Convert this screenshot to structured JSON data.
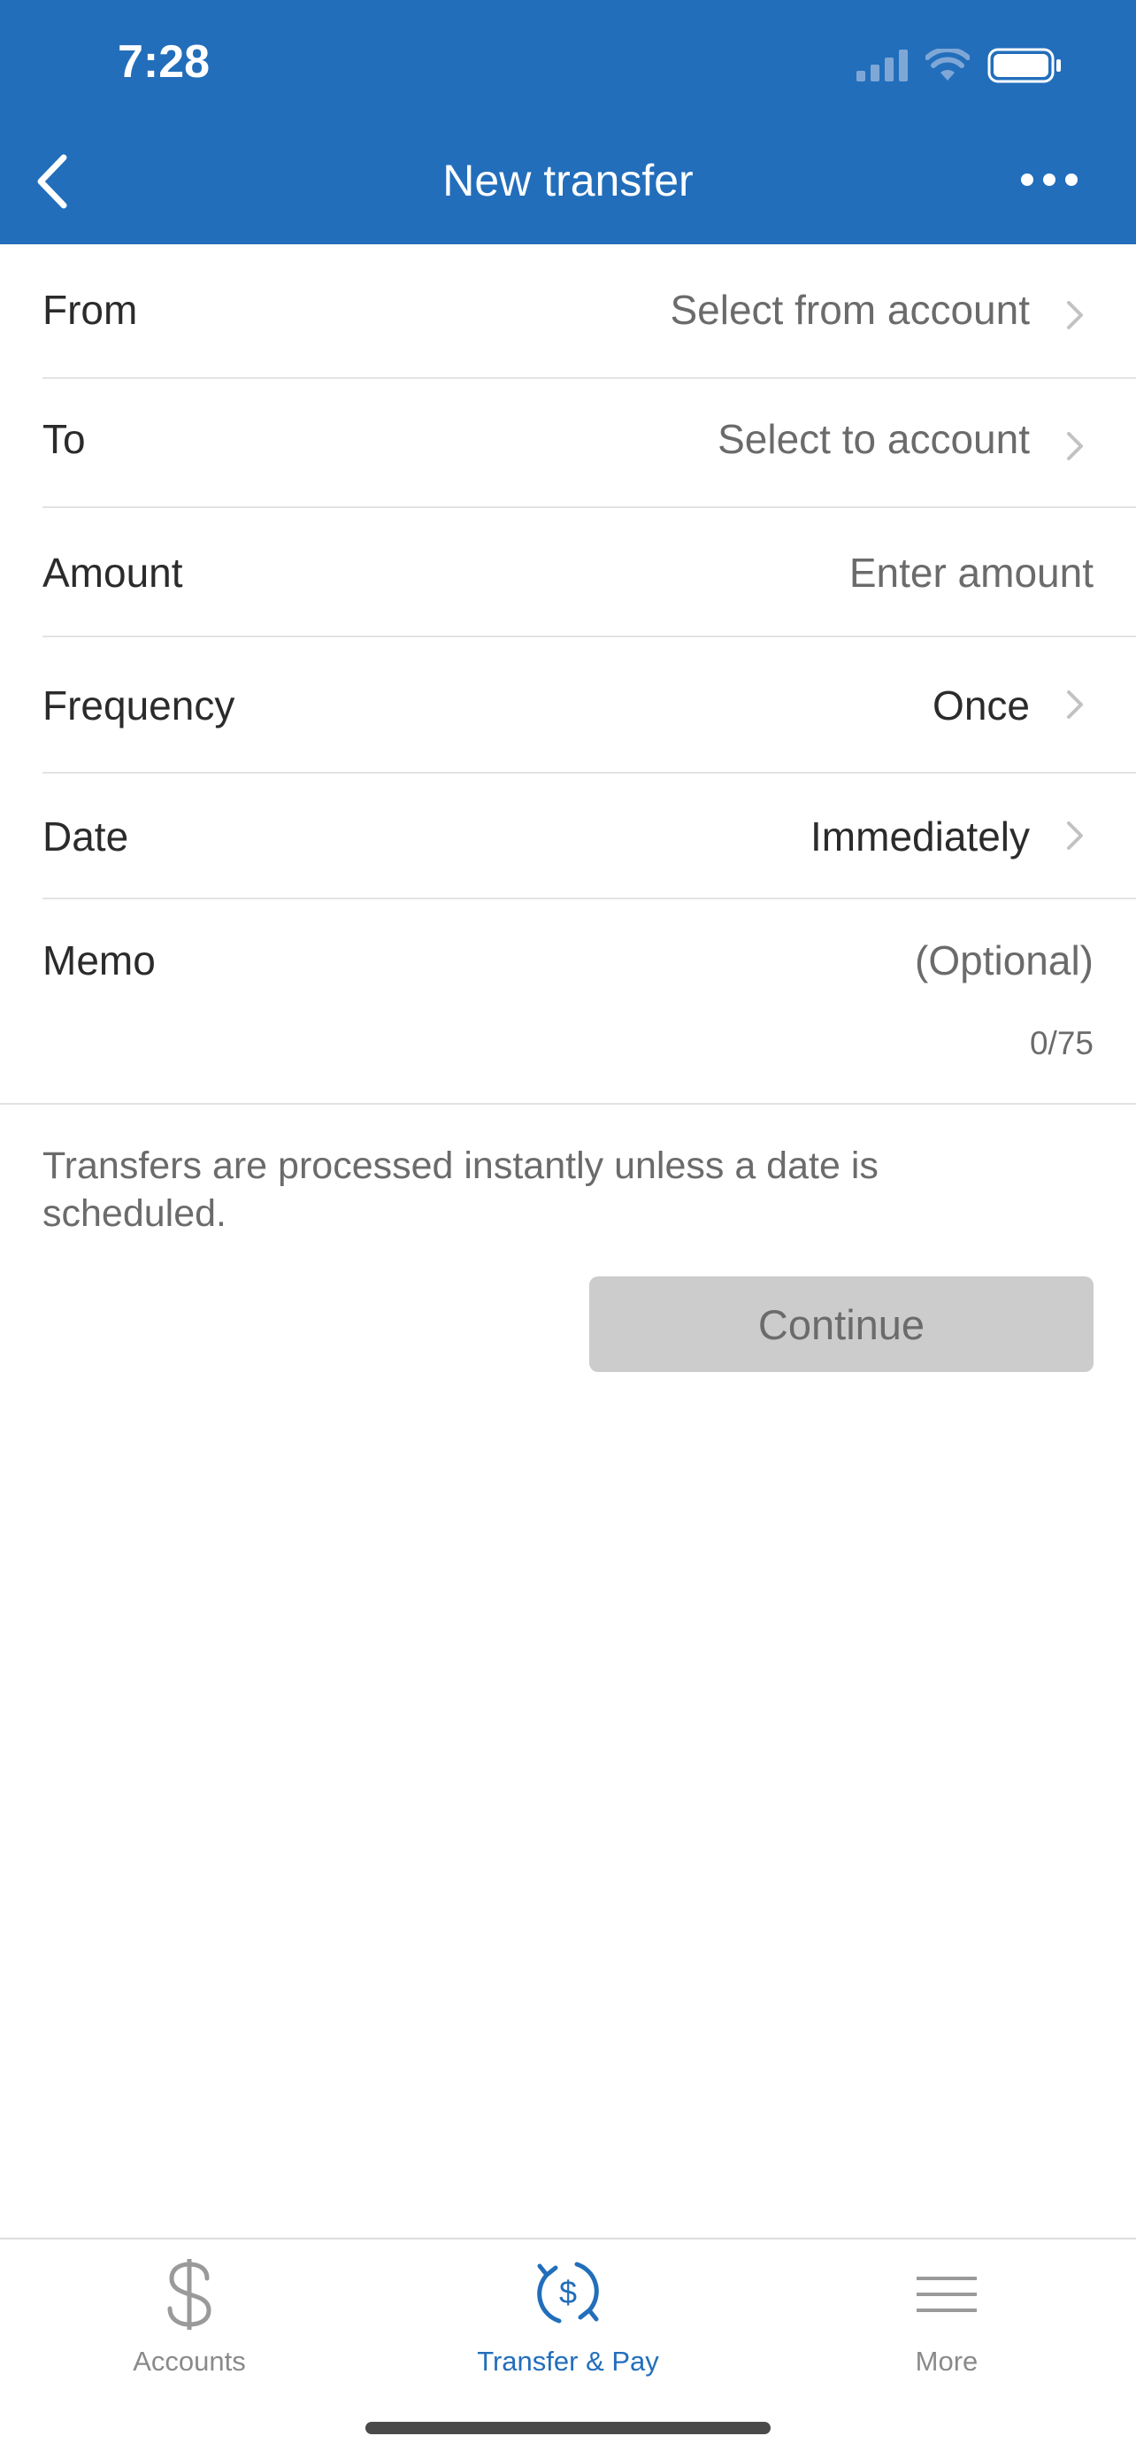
{
  "status_bar": {
    "time": "7:28"
  },
  "nav": {
    "title": "New transfer"
  },
  "form": {
    "from": {
      "label": "From",
      "value": "Select from account"
    },
    "to": {
      "label": "To",
      "value": "Select to account"
    },
    "amount": {
      "label": "Amount",
      "placeholder": "Enter amount"
    },
    "frequency": {
      "label": "Frequency",
      "value": "Once"
    },
    "date": {
      "label": "Date",
      "value": "Immediately"
    },
    "memo": {
      "label": "Memo",
      "placeholder": "(Optional)",
      "counter": "0/75"
    }
  },
  "note": "Transfers are processed instantly unless a date is scheduled.",
  "continue_label": "Continue",
  "tabs": [
    {
      "label": "Accounts",
      "icon": "dollar-icon",
      "active": false
    },
    {
      "label": "Transfer & Pay",
      "icon": "transfer-pay-icon",
      "active": true
    },
    {
      "label": "More",
      "icon": "menu-icon",
      "active": false
    }
  ],
  "colors": {
    "brand": "#226ebb",
    "disabled_button": "#cccccc",
    "muted_text": "#6b6b6b"
  }
}
